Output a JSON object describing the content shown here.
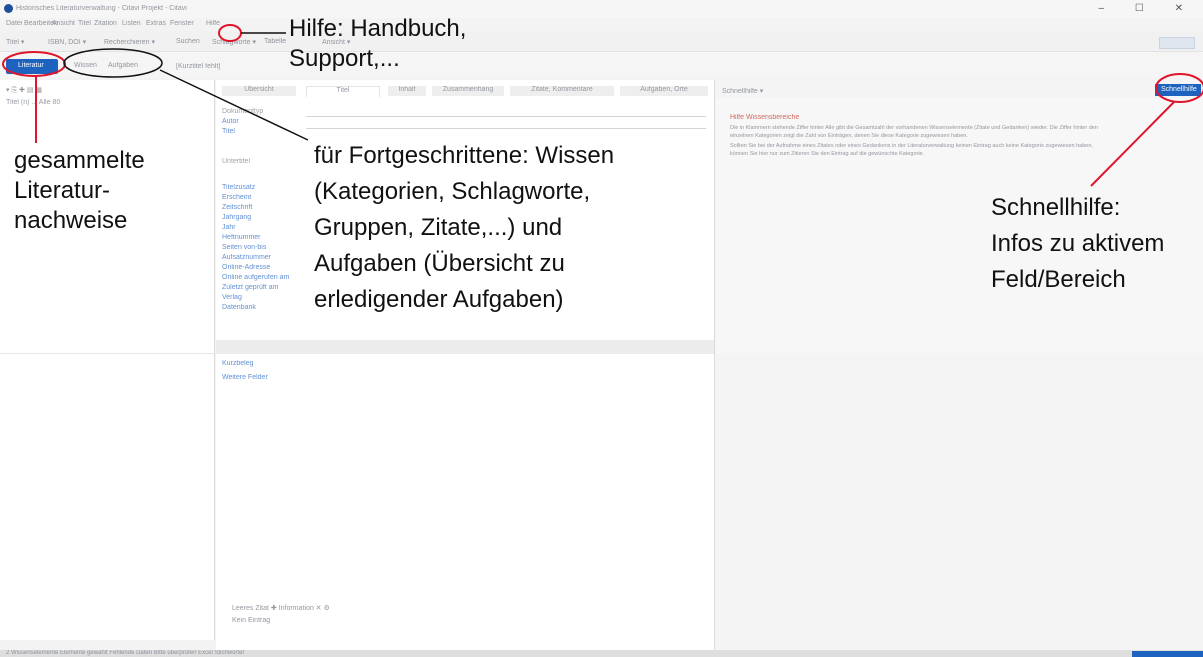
{
  "window": {
    "title": "Historisches Literaturverwaltung - Citavi Projekt - Citavi",
    "controls": "– ☐ ✕"
  },
  "menu": {
    "items": [
      "Datei",
      "Bearbeiten",
      "Ansicht",
      "Titel",
      "Zitation",
      "Listen",
      "Extras",
      "Fenster",
      "Hilfe"
    ]
  },
  "toolbar": {
    "items": [
      "Titel ▾",
      "ISBN, DOI ▾",
      "Recherchieren ▾",
      "Suchen",
      "Schlagworte ▾",
      "Tabelle",
      "Ansicht ▾"
    ]
  },
  "nav": {
    "literature_button": "Literatur",
    "knowledge_button": "Wissen",
    "tasks_button": "Aufgaben",
    "project_label": "[Kurztitel fehlt]"
  },
  "left_panel": {
    "search_placeholder": "Titel (n) ... Alle 80"
  },
  "tabs": [
    "Übersicht",
    "Titel",
    "Inhalt",
    "Zusammenhang",
    "Zitate, Kommentare",
    "Aufgaben, Orte"
  ],
  "fields": [
    "Dokumenttyp",
    "Autor",
    "Titel",
    "Untertitel",
    "Titelzusatz",
    "Erscheint",
    "Zeitschrift",
    "Jahrgang",
    "Jahr",
    "Heftnummer",
    "Seiten von-bis",
    "Aufsatznummer",
    "Online-Adresse",
    "Online aufgerufen am",
    "Zuletzt geprüft am",
    "Verlag",
    "Datenbank",
    "Kurzbeleg",
    "Weitere Felder"
  ],
  "bottom_tools": {
    "label": "Leeres Zitat  ✚ Information  ✕  ⚙",
    "note": "Kein Eintrag"
  },
  "right_panel": {
    "header": "Schnellhilfe ▾",
    "quick_help_button": "Schnellhilfe",
    "help_title": "Hilfe Wissensbereiche",
    "help_lines": [
      "Die in Klammern stehende Ziffer hinter Alle gibt die Gesamtzahl der vorhandenen Wissenselemente (Zitate und Gedanken) wieder. Die Ziffer hinter den",
      "einzelnen Kategorien zeigt die Zahl von Einträgen, denen Sie diese Kategorie zugewiesen haben.",
      "Sollten Sie bei der Aufnahme eines Zitates oder eines Gedankens in der Literaturverwaltung keinen Eintrag auch keine Kategorie zugewiesen haben,",
      "können Sie hier nur zum Zitieren Sie den Eintrag auf die gewünschte Kategorie."
    ]
  },
  "status": {
    "left": "2 Wissenselemente   Elemente gewählt   Fehlende Daten   Bitte überprüfen   Excel Stichwörter"
  },
  "annotations": {
    "help": [
      "Hilfe: Handbuch,",
      "Support,..."
    ],
    "literature": [
      "gesammelte",
      "Literatur-",
      "nachweise"
    ],
    "advanced": [
      "für Fortgeschrittene: Wissen",
      "(Kategorien, Schlagworte,",
      "Gruppen, Zitate,...) und",
      "Aufgaben (Übersicht zu",
      "erledigender Aufgaben)"
    ],
    "quickhelp": [
      "Schnellhilfe:",
      "Infos zu aktivem",
      "Feld/Bereich"
    ]
  },
  "colors": {
    "accent": "#1e62bf",
    "annotation": "#e0142a"
  }
}
